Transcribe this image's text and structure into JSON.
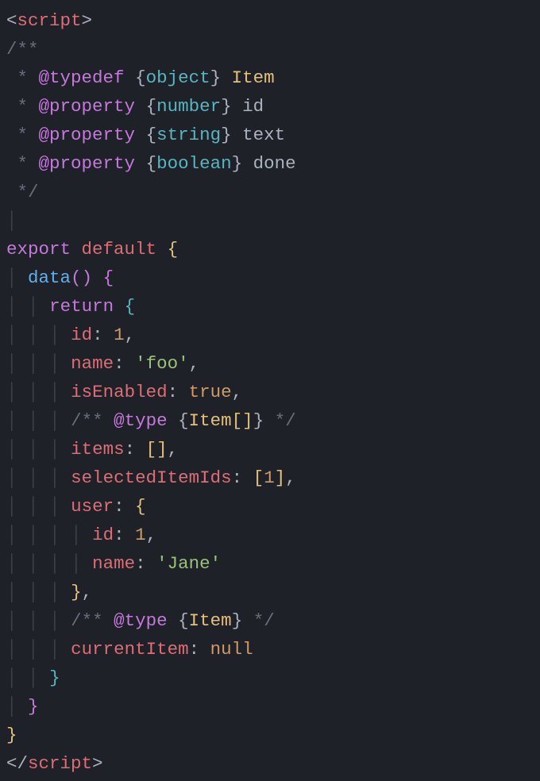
{
  "tag": {
    "open_lt": "<",
    "open_name": "script",
    "open_gt": ">",
    "close_lt": "</",
    "close_name": "script",
    "close_gt": ">"
  },
  "jsdoc": {
    "open": "/**",
    "star": " *",
    "close": " */",
    "line1": {
      "tag": "@typedef",
      "braceL": "{",
      "type": "object",
      "braceR": "}",
      "name": "Item"
    },
    "line2": {
      "tag": "@property",
      "braceL": "{",
      "type": "number",
      "braceR": "}",
      "name": "id"
    },
    "line3": {
      "tag": "@property",
      "braceL": "{",
      "type": "string",
      "braceR": "}",
      "name": "text"
    },
    "line4": {
      "tag": "@property",
      "braceL": "{",
      "type": "boolean",
      "braceR": "}",
      "name": "done"
    }
  },
  "code": {
    "export": "export",
    "default": "default",
    "lbrace": "{",
    "rbrace": "}",
    "data_fn": "data",
    "lparen": "(",
    "rparen": ")",
    "return": "return",
    "id_key": "id",
    "id_val": "1",
    "name_key": "name",
    "name_val": "'foo'",
    "enabled_key": "isEnabled",
    "enabled_val": "true",
    "type_comment1": {
      "open": "/**",
      "tag": "@type",
      "braceL": "{",
      "type": "Item[]",
      "braceR": "}",
      "close": "*/"
    },
    "items_key": "items",
    "items_lb": "[",
    "items_rb": "]",
    "selected_key": "selectedItemIds",
    "selected_lb": "[",
    "selected_val": "1",
    "selected_rb": "]",
    "user_key": "user",
    "user_id_key": "id",
    "user_id_val": "1",
    "user_name_key": "name",
    "user_name_val": "'Jane'",
    "type_comment2": {
      "open": "/**",
      "tag": "@type",
      "braceL": "{",
      "type": "Item",
      "braceR": "}",
      "close": "*/"
    },
    "current_key": "currentItem",
    "null": "null",
    "colon": ":",
    "comma": ","
  },
  "guide": "│"
}
